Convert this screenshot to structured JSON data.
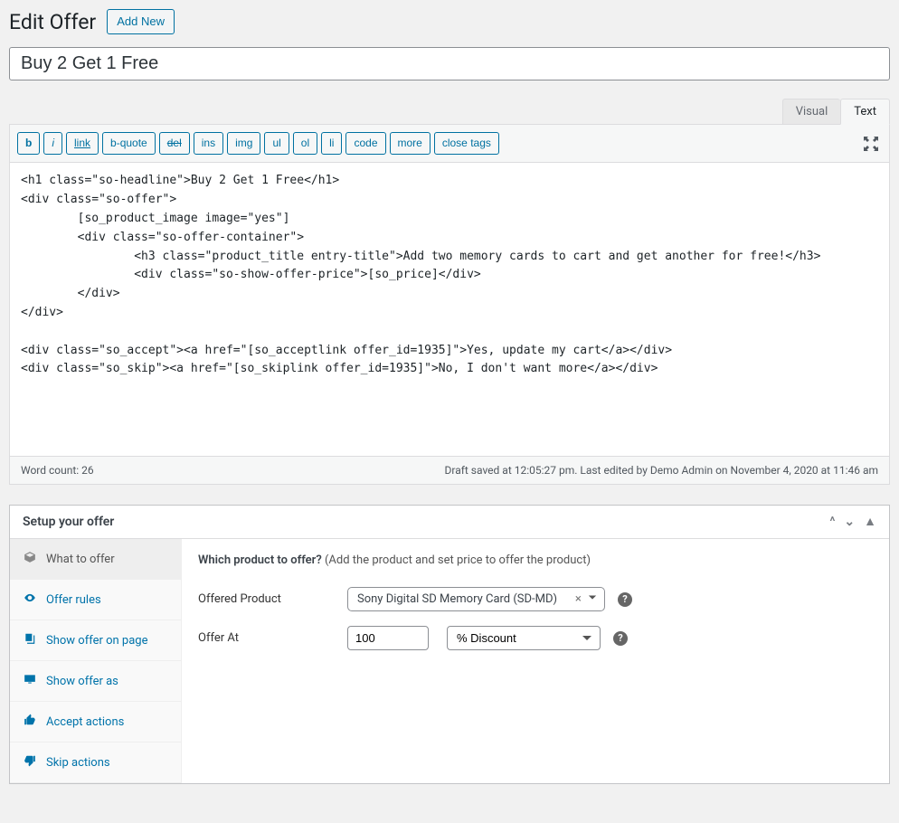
{
  "header": {
    "title": "Edit Offer",
    "add_new": "Add New"
  },
  "post": {
    "title": "Buy 2 Get 1 Free"
  },
  "editor": {
    "tabs": {
      "visual": "Visual",
      "text": "Text"
    },
    "quicktags": [
      "b",
      "i",
      "link",
      "b-quote",
      "del",
      "ins",
      "img",
      "ul",
      "ol",
      "li",
      "code",
      "more",
      "close tags"
    ],
    "content": "<h1 class=\"so-headline\">Buy 2 Get 1 Free</h1>\n<div class=\"so-offer\">\n        [so_product_image image=\"yes\"]\n        <div class=\"so-offer-container\">\n                <h3 class=\"product_title entry-title\">Add two memory cards to cart and get another for free!</h3>\n                <div class=\"so-show-offer-price\">[so_price]</div>\n        </div>\n</div>\n\n<div class=\"so_accept\"><a href=\"[so_acceptlink offer_id=1935]\">Yes, update my cart</a></div>\n<div class=\"so_skip\"><a href=\"[so_skiplink offer_id=1935]\">No, I don't want more</a></div>",
    "status": {
      "word_count": "Word count: 26",
      "draft_info": "Draft saved at 12:05:27 pm. Last edited by Demo Admin on November 4, 2020 at 11:46 am"
    }
  },
  "metabox": {
    "title": "Setup your offer",
    "nav": [
      {
        "label": "What to offer"
      },
      {
        "label": "Offer rules"
      },
      {
        "label": "Show offer on page"
      },
      {
        "label": "Show offer as"
      },
      {
        "label": "Accept actions"
      },
      {
        "label": "Skip actions"
      }
    ],
    "content": {
      "heading": "Which product to offer?",
      "subheading": "(Add the product and set price to offer the product)",
      "offered_product_label": "Offered Product",
      "offered_product_value": "Sony Digital SD Memory Card (SD-MD)",
      "offer_at_label": "Offer At",
      "offer_at_value": "100",
      "discount_type": "% Discount"
    }
  }
}
